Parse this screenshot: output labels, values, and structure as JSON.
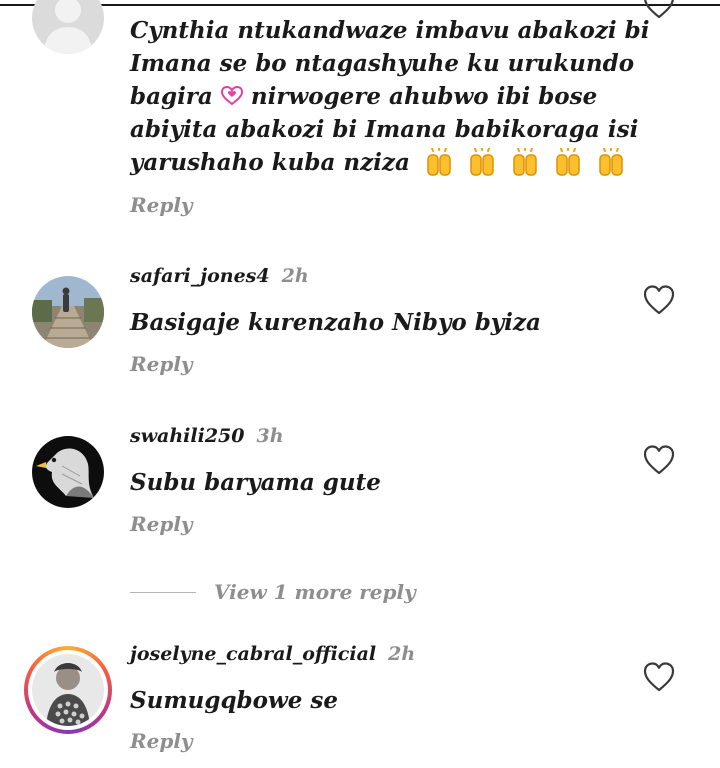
{
  "comments": [
    {
      "username": "",
      "time": "",
      "lines": [
        "Cynthia ntukandwaze imbavu abakozi bi",
        "Imana se bo ntagashyuhe ku urukundo",
        "bagira",
        "nirwogere ahubwo ibi bose",
        "abiyita abakozi bi Imana babikoraga isi",
        "yarushaho kuba nziza"
      ],
      "emojis": [
        "two-hearts",
        "clapping-hands"
      ],
      "reply_label": "Reply"
    },
    {
      "username": "safari_jones4",
      "time": "2h",
      "text": "Basigaje kurenzaho Nibyo byiza",
      "reply_label": "Reply"
    },
    {
      "username": "swahili250",
      "time": "3h",
      "text": "Subu baryama gute",
      "reply_label": "Reply"
    },
    {
      "username": "joselyne_cabral_official",
      "time": "2h",
      "text": "Sumugqbowe se",
      "reply_label": "Reply"
    }
  ],
  "view_more": {
    "label": "View 1 more reply"
  },
  "icons": {
    "like": "heart-outline-icon",
    "emoji_heart": "two-hearts-icon",
    "emoji_clap": "clapping-hands-icon"
  },
  "colors": {
    "text": "#1a1a1a",
    "muted": "#8e8e8e",
    "story_ring": [
      "#f9b233",
      "#f56040",
      "#c13584",
      "#833ab4"
    ]
  }
}
